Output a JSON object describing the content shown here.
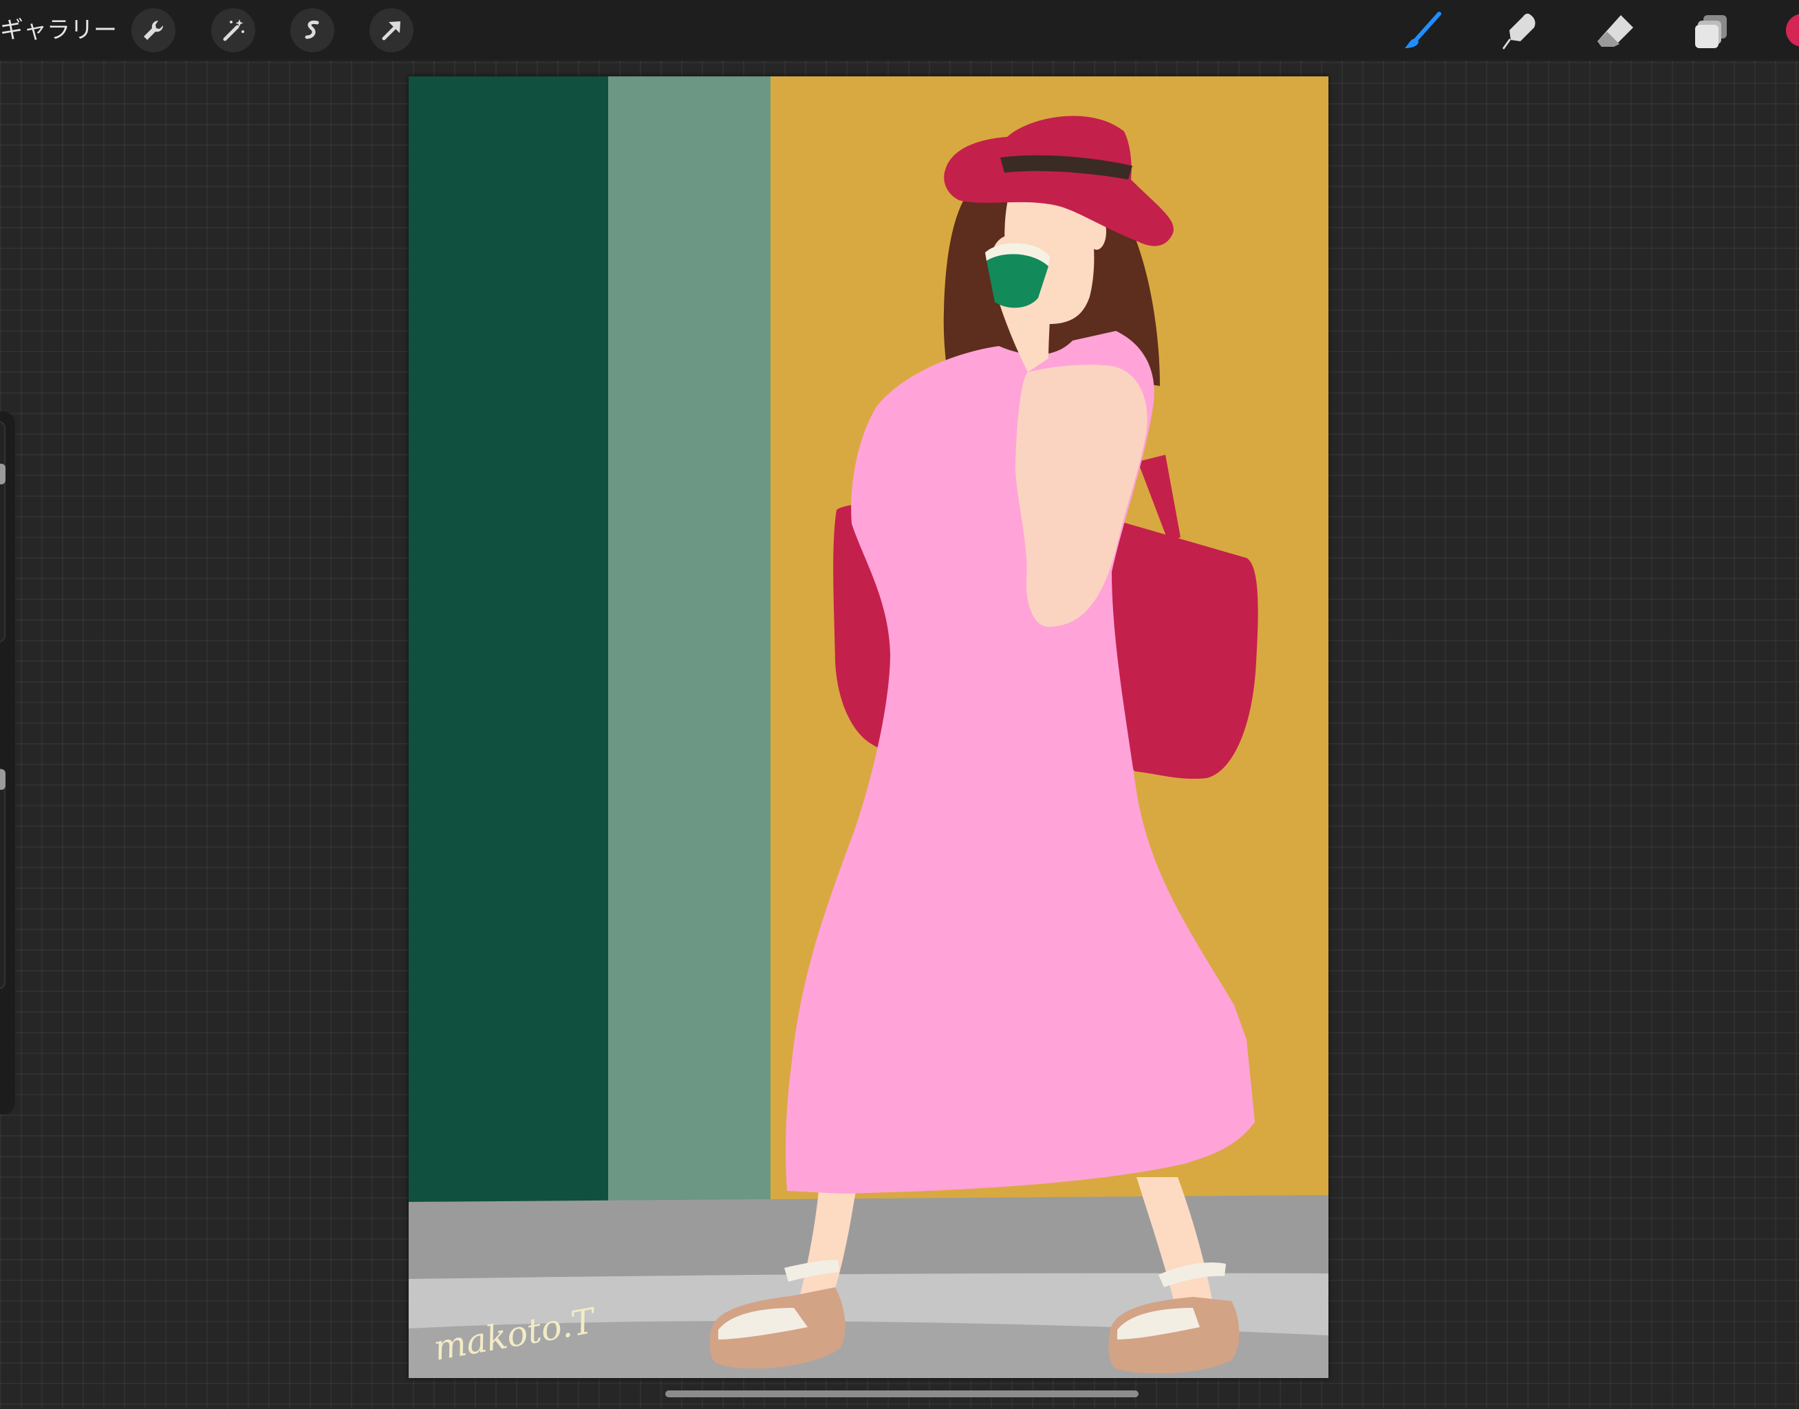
{
  "toolbar": {
    "gallery_label": "ギャラリー",
    "left_tools": [
      "wrench-icon",
      "magic-wand-icon",
      "selection-icon",
      "transform-arrow-icon"
    ],
    "right_tools": [
      "brush-icon",
      "smudge-icon",
      "eraser-icon",
      "layers-icon",
      "color-swatch"
    ],
    "active_tool": "brush-icon",
    "accent_color": "#1f8fff",
    "current_color": "#d42554"
  },
  "canvas": {
    "signature": "makoto.T",
    "palette": {
      "dark_green": "#10503f",
      "sage": "#6b9784",
      "mustard": "#d8a941",
      "dress_pink": "#ffa3d9",
      "hat_red": "#c4204c",
      "hair_brown": "#5d2d1d",
      "skin": "#fddac2",
      "sidewalk": "#9a9a9a"
    }
  }
}
